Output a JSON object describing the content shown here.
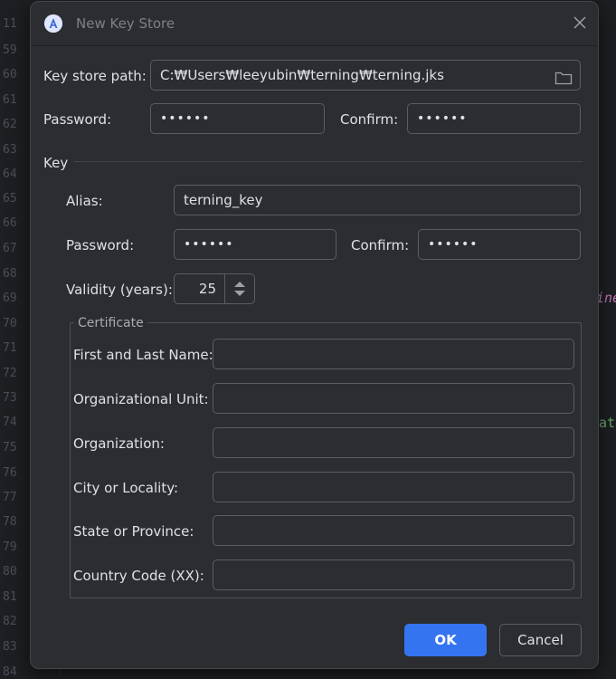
{
  "editor": {
    "line_numbers": [
      "11",
      "59",
      "60",
      "61",
      "62",
      "63",
      "64",
      "65",
      "66",
      "67",
      "68",
      "69",
      "70",
      "71",
      "72",
      "73",
      "74",
      "75",
      "76",
      "77",
      "78",
      "79",
      "80",
      "81",
      "82",
      "83",
      "84"
    ],
    "fragments": [
      "ine",
      "at"
    ]
  },
  "dialog": {
    "title": "New Key Store",
    "keystore": {
      "path_label": "Key store path:",
      "path_value": "C:₩Users₩leeyubin₩terning₩terning.jks",
      "password_label": "Password:",
      "password_value": "••••••",
      "confirm_label": "Confirm:",
      "confirm_value": "••••••"
    },
    "key": {
      "section_label": "Key",
      "alias_label": "Alias:",
      "alias_value": "terning_key",
      "password_label": "Password:",
      "password_value": "••••••",
      "confirm_label": "Confirm:",
      "confirm_value": "••••••",
      "validity_label": "Validity (years):",
      "validity_value": "25"
    },
    "certificate": {
      "title": "Certificate",
      "first_last_label": "First and Last Name:",
      "org_unit_label": "Organizational Unit:",
      "organization_label": "Organization:",
      "city_label": "City or Locality:",
      "state_label": "State or Province:",
      "country_label": "Country Code (XX):"
    },
    "buttons": {
      "ok": "OK",
      "cancel": "Cancel"
    }
  }
}
